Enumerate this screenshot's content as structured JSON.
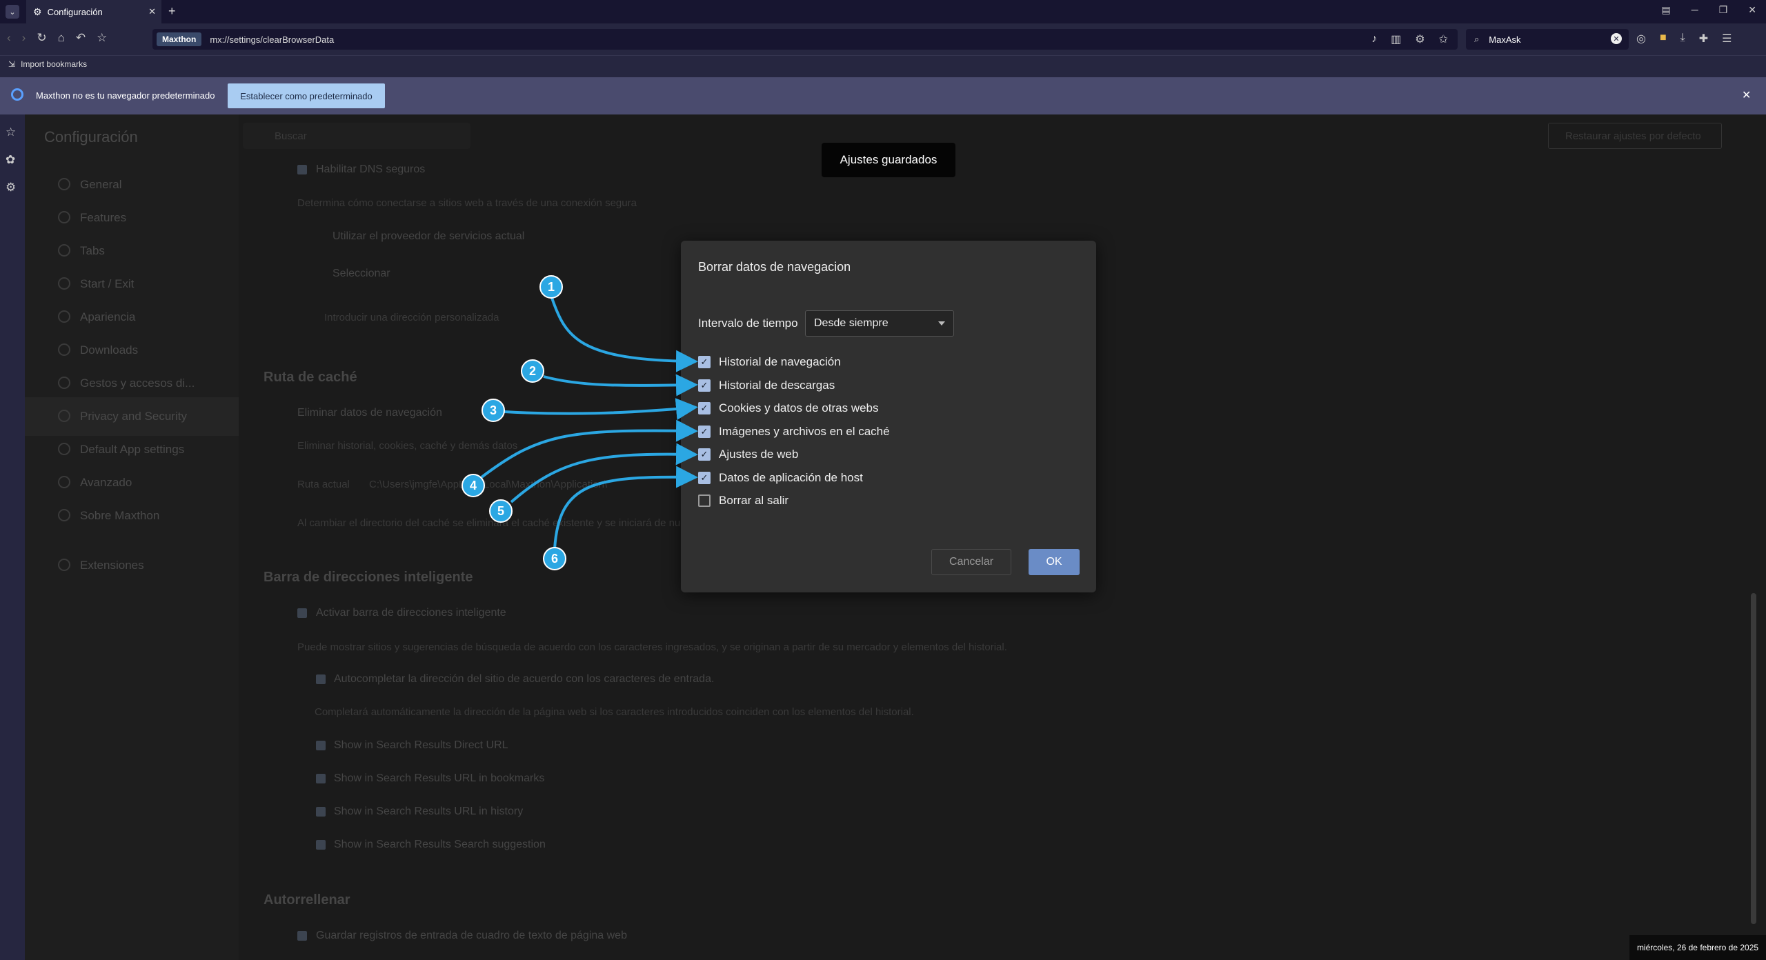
{
  "browser": {
    "tab_title": "Configuración",
    "brand_badge": "Maxthon",
    "url": "mx://settings/clearBrowserData",
    "search_value": "MaxAsk",
    "bookmark": "Import bookmarks"
  },
  "infobar": {
    "message": "Maxthon no es tu navegador predeterminado",
    "button": "Establecer como predeterminado"
  },
  "background_page": {
    "title": "Configuración",
    "search_placeholder": "Buscar",
    "restore_button": "Restaurar ajustes por defecto",
    "sidebar": [
      "General",
      "Features",
      "Tabs",
      "Start / Exit",
      "Apariencia",
      "Downloads",
      "Gestos y accesos di...",
      "Privacy and Security",
      "Default App settings",
      "Avanzado",
      "Sobre Maxthon"
    ],
    "extensions": "Extensiones",
    "dns_checkbox": "Habilitar DNS seguros",
    "dns_desc": "Determina cómo conectarse a sitios web a través de una conexión segura",
    "dns_opt1": "Utilizar el proveedor de servicios actual",
    "dns_opt2": "Seleccionar",
    "dns_placeholder": "Introducir una dirección personalizada",
    "cache_heading": "Ruta de caché",
    "delete_data": "Eliminar datos de navegación",
    "delete_desc": "Eliminar historial, cookies, caché y demás datos",
    "current_path_label": "Ruta actual",
    "current_path_value": "C:\\Users\\jmgfe\\AppData\\Local\\Maxthon\\Application\\",
    "cache_note": "Al cambiar el directorio del caché se eliminará el caché existente y se iniciará de nuevo",
    "smartbar_heading": "Barra de direcciones inteligente",
    "smartbar_checkbox": "Activar barra de direcciones inteligente",
    "smartbar_desc": "Puede mostrar sitios y sugerencias de búsqueda de acuerdo con los caracteres ingresados, y se originan a partir de su mercador y elementos del historial.",
    "autocomplete": "Autocompletar la dirección del sitio de acuerdo con los caracteres de entrada.",
    "autocomplete_desc": "Completará automáticamente la dirección de la página web si los caracteres introducidos coinciden con los elementos del historial.",
    "show_direct": "Show in Search Results Direct URL",
    "show_bookmarks": "Show in Search Results URL in bookmarks",
    "show_history": "Show in Search Results URL in history",
    "show_suggestion": "Show in Search Results Search suggestion",
    "autofill_heading": "Autorrellenar",
    "autofill_checkbox": "Guardar registros de entrada de cuadro de texto de página web"
  },
  "toast": "Ajustes guardados",
  "dialog": {
    "title": "Borrar datos de navegacion",
    "range_label": "Intervalo de tiempo",
    "range_value": "Desde siempre",
    "options": [
      {
        "label": "Historial de navegación",
        "checked": true
      },
      {
        "label": "Historial de descargas",
        "checked": true
      },
      {
        "label": "Cookies y datos de otras webs",
        "checked": true
      },
      {
        "label": "Imágenes y archivos en el caché",
        "checked": true
      },
      {
        "label": "Ajustes de web",
        "checked": true
      },
      {
        "label": "Datos de aplicación de host",
        "checked": true
      },
      {
        "label": "Borrar al salir",
        "checked": false
      }
    ],
    "cancel": "Cancelar",
    "ok": "OK"
  },
  "callouts": [
    "1",
    "2",
    "3",
    "4",
    "5",
    "6"
  ],
  "callout_color": "#2ba7e3",
  "taskbar_date": "miércoles, 26 de febrero de 2025"
}
